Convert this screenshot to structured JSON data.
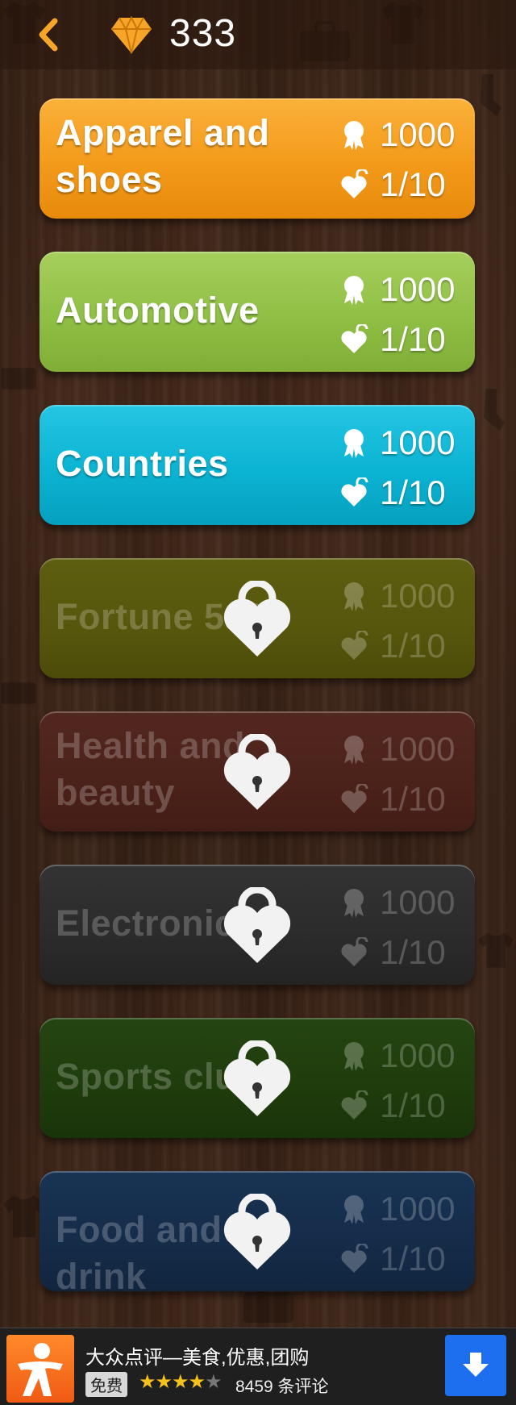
{
  "header": {
    "back_icon": "chevron-left-icon",
    "gem_icon": "diamond-icon",
    "score": "333"
  },
  "colors": {
    "accent": "#f7a528",
    "apparel": "#f39a1a",
    "automotive": "#8fbf45",
    "countries": "#0bb3d2",
    "fortune": "#56560d",
    "health": "#4b221a",
    "electronics": "#2b2b2b",
    "sports": "#1f3c0c",
    "food": "#152c49"
  },
  "categories": [
    {
      "title": "Apparel and shoes",
      "points": "1000",
      "progress": "1/10",
      "locked": false
    },
    {
      "title": "Automotive",
      "points": "1000",
      "progress": "1/10",
      "locked": false
    },
    {
      "title": "Countries",
      "points": "1000",
      "progress": "1/10",
      "locked": false
    },
    {
      "title": "Fortune 500",
      "points": "1000",
      "progress": "1/10",
      "locked": true
    },
    {
      "title": "Health and beauty",
      "points": "1000",
      "progress": "1/10",
      "locked": true
    },
    {
      "title": "Electronics",
      "points": "1000",
      "progress": "1/10",
      "locked": true
    },
    {
      "title": "Sports club",
      "points": "1000",
      "progress": "1/10",
      "locked": true
    },
    {
      "title": "Food and drink",
      "points": "1000",
      "progress": "1/10",
      "locked": true
    }
  ],
  "ad": {
    "title": "大众点评—美食,优惠,团购",
    "tag": "免费",
    "stars_on": "★★★★",
    "stars_off": "★",
    "reviews": "8459 条评论",
    "download_icon": "download-arrow-icon"
  }
}
